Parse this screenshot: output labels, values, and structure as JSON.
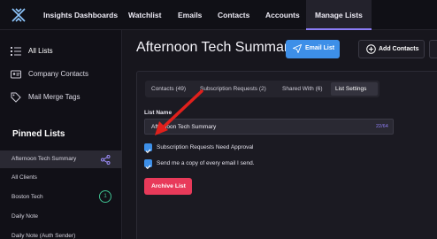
{
  "topnav": {
    "items": [
      "Insights Dashboards",
      "Watchlist",
      "Emails",
      "Contacts",
      "Accounts",
      "Manage Lists"
    ],
    "active": "Manage Lists",
    "accent": "#8b7cf6"
  },
  "sidebar": {
    "items": [
      {
        "label": "All Lists",
        "icon": "list-icon"
      },
      {
        "label": "Company Contacts",
        "icon": "contact-card-icon"
      },
      {
        "label": "Mail Merge Tags",
        "icon": "tag-icon"
      }
    ],
    "pinned_heading": "Pinned Lists",
    "pinned": [
      {
        "label": "Afternoon Tech Summary"
      },
      {
        "label": "All Clients"
      },
      {
        "label": "Boston Tech",
        "badge": "1"
      },
      {
        "label": "Daily Note"
      },
      {
        "label": "Daily Note (Auth Sender)"
      }
    ]
  },
  "main": {
    "title": "Afternoon Tech Summary",
    "email_list_label": "Email List",
    "add_contacts_label": "Add Contacts",
    "tabs": [
      {
        "label": "Contacts (49)"
      },
      {
        "label": "Subscription Requests (2)"
      },
      {
        "label": "Shared With (6)"
      },
      {
        "label": "List Settings",
        "active": true
      }
    ],
    "list_name_label": "List Name",
    "list_name_value": "Afternoon Tech Summary",
    "char_count": "22/64",
    "checkboxes": [
      {
        "label": "Subscription Requests Need Approval",
        "checked": true
      },
      {
        "label": "Send me a copy of every email I send.",
        "checked": true
      }
    ],
    "archive_label": "Archive List"
  },
  "colors": {
    "primary_button": "#3d8fe8",
    "danger_button": "#e83a5a",
    "annotation_arrow": "#e0201c"
  }
}
